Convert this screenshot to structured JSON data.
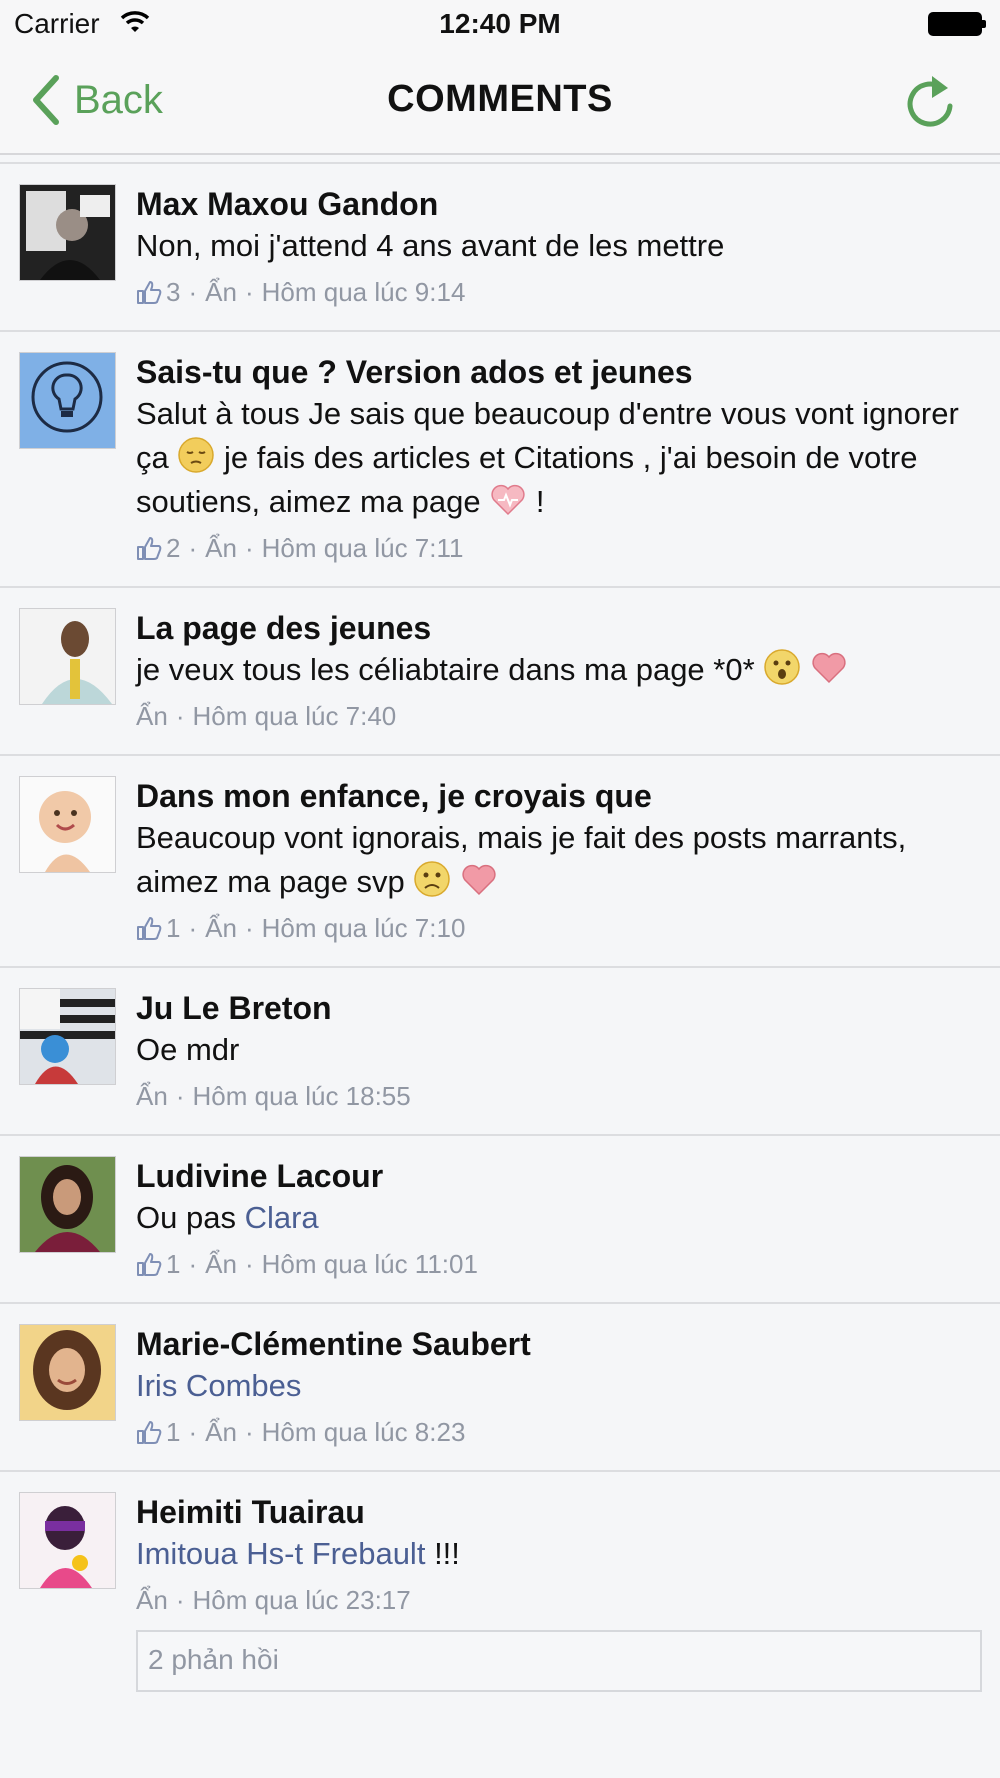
{
  "status_bar": {
    "carrier": "Carrier",
    "time": "12:40 PM"
  },
  "nav": {
    "back_label": "Back",
    "title": "COMMENTS"
  },
  "colors": {
    "accent_green": "#5aa15a",
    "link_blue": "#4b5f93",
    "meta_gray": "#9197a3"
  },
  "comments": [
    {
      "author": "Max Maxou Gandon",
      "text": "Non, moi j'attend 4 ans avant de les mettre",
      "likes": "3",
      "hide": "Ẩn",
      "time": "Hôm qua lúc 9:14"
    },
    {
      "author": "Sais-tu que ? Version ados et jeunes",
      "text_a": "Salut à tous Je sais que beaucoup d'entre vous vont ignorer ça",
      "text_b": "je fais des articles et Citations , j'ai besoin de votre soutiens, aimez ma page",
      "text_c": "!",
      "likes": "2",
      "hide": "Ẩn",
      "time": "Hôm qua lúc 7:11"
    },
    {
      "author": "La page des jeunes",
      "text": "je veux tous les céliabtaire dans ma page *0*",
      "hide": "Ẩn",
      "time": "Hôm qua lúc 7:40"
    },
    {
      "author": "Dans mon enfance, je croyais que",
      "text": "Beaucoup vont ignorais, mais je fait des posts marrants, aimez ma page svp",
      "likes": "1",
      "hide": "Ẩn",
      "time": "Hôm qua lúc 7:10"
    },
    {
      "author": "Ju Le Breton",
      "text": "Oe mdr",
      "hide": "Ẩn",
      "time": "Hôm qua lúc 18:55"
    },
    {
      "author": "Ludivine Lacour",
      "text": "Ou pas",
      "mention": "Clara",
      "likes": "1",
      "hide": "Ẩn",
      "time": "Hôm qua lúc 11:01"
    },
    {
      "author": "Marie-Clémentine Saubert",
      "mention": "Iris Combes",
      "likes": "1",
      "hide": "Ẩn",
      "time": "Hôm qua lúc 8:23"
    },
    {
      "author": "Heimiti Tuairau",
      "mention": "Imitoua Hs-t Frebault",
      "text": "!!!",
      "hide": "Ẩn",
      "time": "Hôm qua lúc 23:17",
      "replies": "2 phản hồi"
    }
  ],
  "meta_separator": "·"
}
